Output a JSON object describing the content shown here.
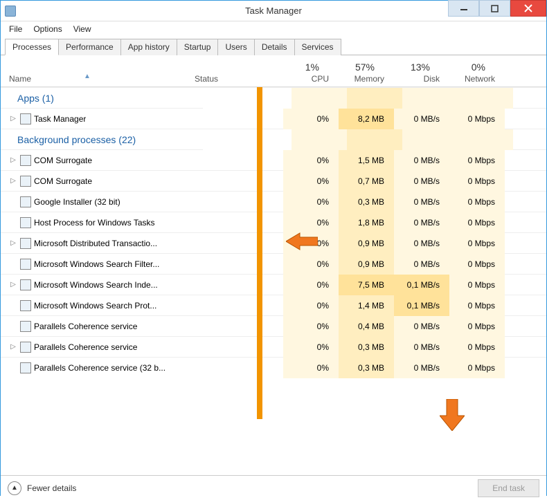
{
  "window": {
    "title": "Task Manager",
    "menu": [
      "File",
      "Options",
      "View"
    ],
    "tabs": [
      "Processes",
      "Performance",
      "App history",
      "Startup",
      "Users",
      "Details",
      "Services"
    ],
    "active_tab": 0
  },
  "columns": {
    "name": "Name",
    "status": "Status",
    "cpu": {
      "usage": "1%",
      "label": "CPU"
    },
    "memory": {
      "usage": "57%",
      "label": "Memory"
    },
    "disk": {
      "usage": "13%",
      "label": "Disk"
    },
    "network": {
      "usage": "0%",
      "label": "Network"
    }
  },
  "groups": [
    {
      "title": "Apps (1)",
      "rows": [
        {
          "expand": true,
          "icon": "taskmgr",
          "name": "Task Manager",
          "cpu": "0%",
          "mem": "8,2 MB",
          "mem_hot": true,
          "disk": "0 MB/s",
          "net": "0 Mbps"
        }
      ]
    },
    {
      "title": "Background processes (22)",
      "rows": [
        {
          "expand": true,
          "icon": "exe",
          "name": "COM Surrogate",
          "cpu": "0%",
          "mem": "1,5 MB",
          "disk": "0 MB/s",
          "net": "0 Mbps"
        },
        {
          "expand": true,
          "icon": "exe",
          "name": "COM Surrogate",
          "cpu": "0%",
          "mem": "0,7 MB",
          "disk": "0 MB/s",
          "net": "0 Mbps"
        },
        {
          "expand": false,
          "icon": "google",
          "name": "Google Installer (32 bit)",
          "cpu": "0%",
          "mem": "0,3 MB",
          "disk": "0 MB/s",
          "net": "0 Mbps"
        },
        {
          "expand": false,
          "icon": "exe",
          "name": "Host Process for Windows Tasks",
          "cpu": "0%",
          "mem": "1,8 MB",
          "disk": "0 MB/s",
          "net": "0 Mbps"
        },
        {
          "expand": true,
          "icon": "dtc",
          "name": "Microsoft Distributed Transactio...",
          "cpu": "0%",
          "mem": "0,9 MB",
          "disk": "0 MB/s",
          "net": "0 Mbps"
        },
        {
          "expand": false,
          "icon": "search",
          "name": "Microsoft Windows Search Filter...",
          "cpu": "0%",
          "mem": "0,9 MB",
          "disk": "0 MB/s",
          "net": "0 Mbps"
        },
        {
          "expand": true,
          "icon": "search",
          "name": "Microsoft Windows Search Inde...",
          "cpu": "0%",
          "mem": "7,5 MB",
          "mem_hot": true,
          "disk": "0,1 MB/s",
          "disk_hot": true,
          "net": "0 Mbps"
        },
        {
          "expand": false,
          "icon": "search",
          "name": "Microsoft Windows Search Prot...",
          "cpu": "0%",
          "mem": "1,4 MB",
          "disk": "0,1 MB/s",
          "disk_hot": true,
          "net": "0 Mbps"
        },
        {
          "expand": false,
          "icon": "exe",
          "name": "Parallels Coherence service",
          "cpu": "0%",
          "mem": "0,4 MB",
          "disk": "0 MB/s",
          "net": "0 Mbps"
        },
        {
          "expand": true,
          "icon": "exe",
          "name": "Parallels Coherence service",
          "cpu": "0%",
          "mem": "0,3 MB",
          "disk": "0 MB/s",
          "net": "0 Mbps"
        },
        {
          "expand": false,
          "icon": "exe",
          "name": "Parallels Coherence service (32 b...",
          "cpu": "0%",
          "mem": "0,3 MB",
          "disk": "0 MB/s",
          "net": "0 Mbps"
        }
      ]
    }
  ],
  "footer": {
    "fewer_label": "Fewer details",
    "end_task_label": "End task"
  }
}
